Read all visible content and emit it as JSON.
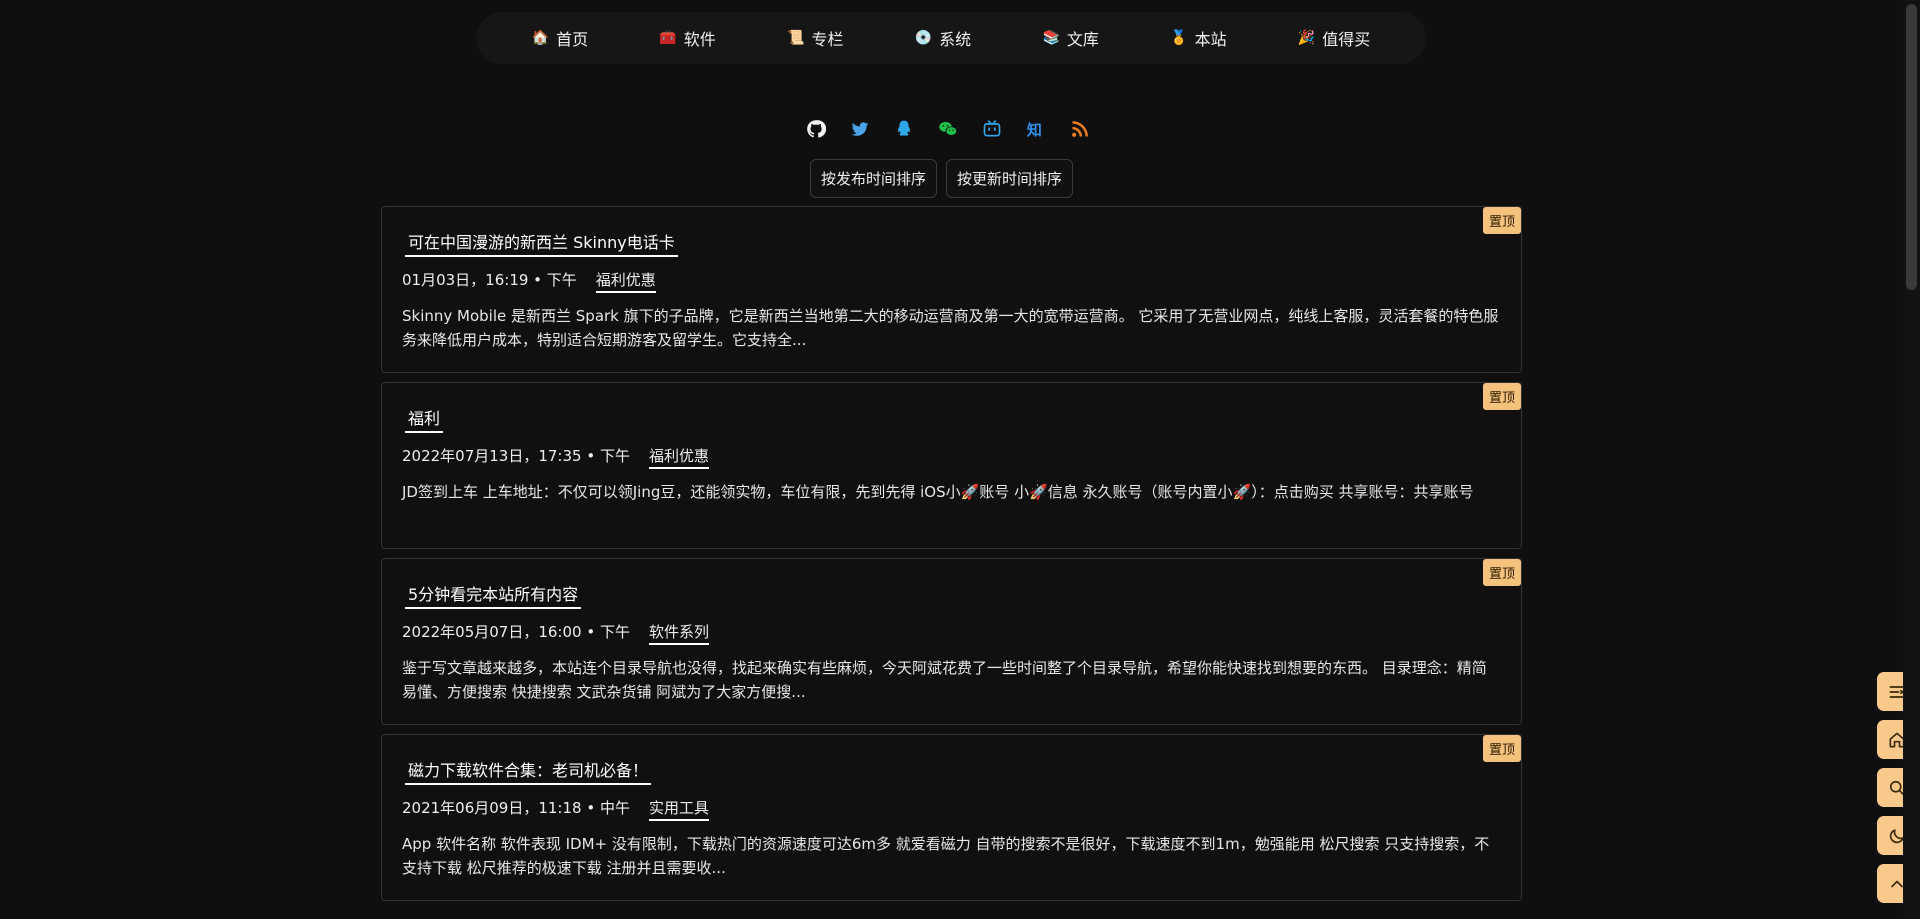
{
  "nav": {
    "items": [
      {
        "label": "首页",
        "icon": "🏠"
      },
      {
        "label": "软件",
        "icon": "🧰"
      },
      {
        "label": "专栏",
        "icon": "📜"
      },
      {
        "label": "系统",
        "icon": "💿"
      },
      {
        "label": "文库",
        "icon": "📚"
      },
      {
        "label": "本站",
        "icon": "🏅"
      },
      {
        "label": "值得买",
        "icon": "🎉"
      }
    ]
  },
  "social": [
    "github-icon",
    "twitter-icon",
    "qq-icon",
    "wechat-icon",
    "bilibili-icon",
    "zhihu-icon",
    "rss-icon"
  ],
  "sort": {
    "by_publish": "按发布时间排序",
    "by_update": "按更新时间排序"
  },
  "posts": [
    {
      "pin": "置顶",
      "title": "可在中国漫游的新西兰 Skinny电话卡",
      "date": "01月03日，16:19 • 下午",
      "category": "福利优惠",
      "excerpt": "Skinny Mobile 是新西兰 Spark 旗下的子品牌，它是新西兰当地第二大的移动运营商及第一大的宽带运营商。 它采用了无营业网点，纯线上客服，灵活套餐的特色服务来降低用户成本，特别适合短期游客及留学生。它支持全..."
    },
    {
      "pin": "置顶",
      "title": "福利",
      "date": "2022年07月13日，17:35 • 下午",
      "category": "福利优惠",
      "excerpt": "JD签到上车 上车地址：不仅可以领Jing豆，还能领实物，车位有限，先到先得 iOS小🚀账号 小🚀信息 永久账号（账号内置小🚀）：点击购买 共享账号：共享账号"
    },
    {
      "pin": "置顶",
      "title": "5分钟看完本站所有内容",
      "date": "2022年05月07日，16:00 • 下午",
      "category": "软件系列",
      "excerpt": "鉴于写文章越来越多，本站连个目录导航也没得，找起来确实有些麻烦，今天阿斌花费了一些时间整了个目录导航，希望你能快速找到想要的东西。 目录理念：精简易懂、方便搜索 快捷搜索 文武杂货铺 阿斌为了大家方便搜..."
    },
    {
      "pin": "置顶",
      "title": "磁力下载软件合集：老司机必备！",
      "date": "2021年06月09日，11:18 • 中午",
      "category": "实用工具",
      "excerpt": "App 软件名称 软件表现 IDM+ 没有限制，下载热门的资源速度可达6m多 就爱看磁力 自带的搜索不是很好，下载速度不到1m，勉强能用 松尺搜索 只支持搜索，不支持下载 松尺推荐的极速下载 注册并且需要收..."
    }
  ],
  "floating": [
    "toc-icon",
    "home-icon",
    "search-icon",
    "moon-icon",
    "chevron-up-icon"
  ],
  "colors": {
    "background": "#0f0f0f",
    "accent": "#f8c98a",
    "pin": "#f5c27d"
  }
}
